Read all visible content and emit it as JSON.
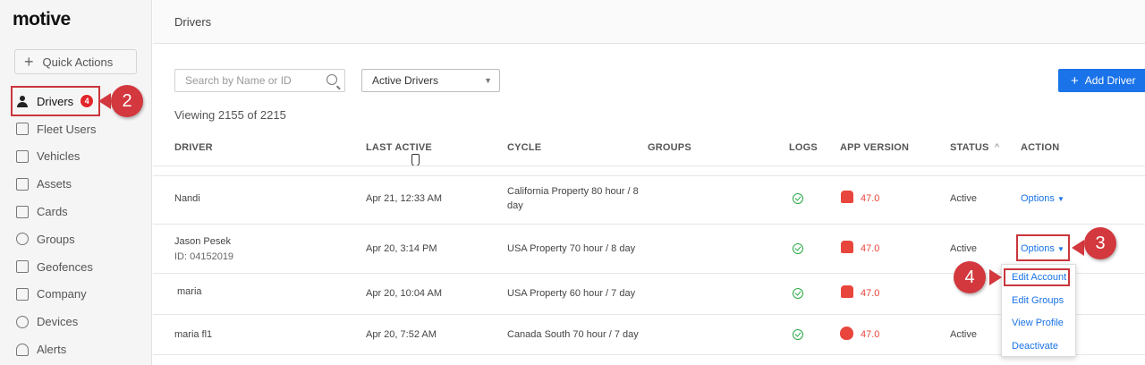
{
  "sidebar": {
    "logo": "motive",
    "quick_actions": "Quick Actions",
    "items": [
      {
        "label": "Drivers",
        "badge": "4"
      },
      {
        "label": "Fleet Users"
      },
      {
        "label": "Vehicles"
      },
      {
        "label": "Assets"
      },
      {
        "label": "Cards"
      },
      {
        "label": "Groups"
      },
      {
        "label": "Geofences"
      },
      {
        "label": "Company"
      },
      {
        "label": "Devices"
      },
      {
        "label": "Alerts"
      }
    ]
  },
  "header": {
    "title": "Drivers"
  },
  "filters": {
    "search_placeholder": "Search by Name or ID",
    "status_select": "Active Drivers",
    "add_label": "Add Driver"
  },
  "viewing": "Viewing 2155 of 2215",
  "table": {
    "headers": {
      "driver": "DRIVER",
      "last_active": "LAST ACTIVE",
      "cycle": "CYCLE",
      "groups": "GROUPS",
      "logs": "LOGS",
      "app_version": "APP VERSION",
      "status": "STATUS",
      "sort_indicator": "^",
      "action": "ACTION"
    },
    "rows": [
      {
        "name": "Nandi",
        "id": "",
        "last_active": "Apr 21, 12:33 AM",
        "cycle_line1": "California Property 80 hour / 8",
        "cycle_line2": "day",
        "platform": "android",
        "version": "47.0",
        "status": "Active",
        "action": "Options"
      },
      {
        "name": "Jason Pesek",
        "id": "ID: 04152019",
        "last_active": "Apr 20, 3:14 PM",
        "cycle_line1": "USA Property 70 hour / 8 day",
        "cycle_line2": "",
        "platform": "android",
        "version": "47.0",
        "status": "Active",
        "action": "Options"
      },
      {
        "name": "maria",
        "id": "",
        "last_active": "Apr 20, 10:04 AM",
        "cycle_line1": "USA Property 60 hour / 7 day",
        "cycle_line2": "",
        "platform": "android",
        "version": "47.0",
        "status": "",
        "action": ""
      },
      {
        "name": "maria fl1",
        "id": "",
        "last_active": "Apr 20, 7:52 AM",
        "cycle_line1": "Canada South 70 hour / 7 day",
        "cycle_line2": "",
        "platform": "apple",
        "version": "47.0",
        "status": "Active",
        "action": ""
      }
    ]
  },
  "options_menu": {
    "items": [
      "Edit Account",
      "Edit Groups",
      "View Profile",
      "Deactivate"
    ]
  },
  "callouts": {
    "drivers": "2",
    "options": "3",
    "edit_account": "4"
  },
  "colors": {
    "accent": "#1a73e8",
    "highlight": "#c9363c",
    "success": "#27a844",
    "android": "#e8453c"
  }
}
